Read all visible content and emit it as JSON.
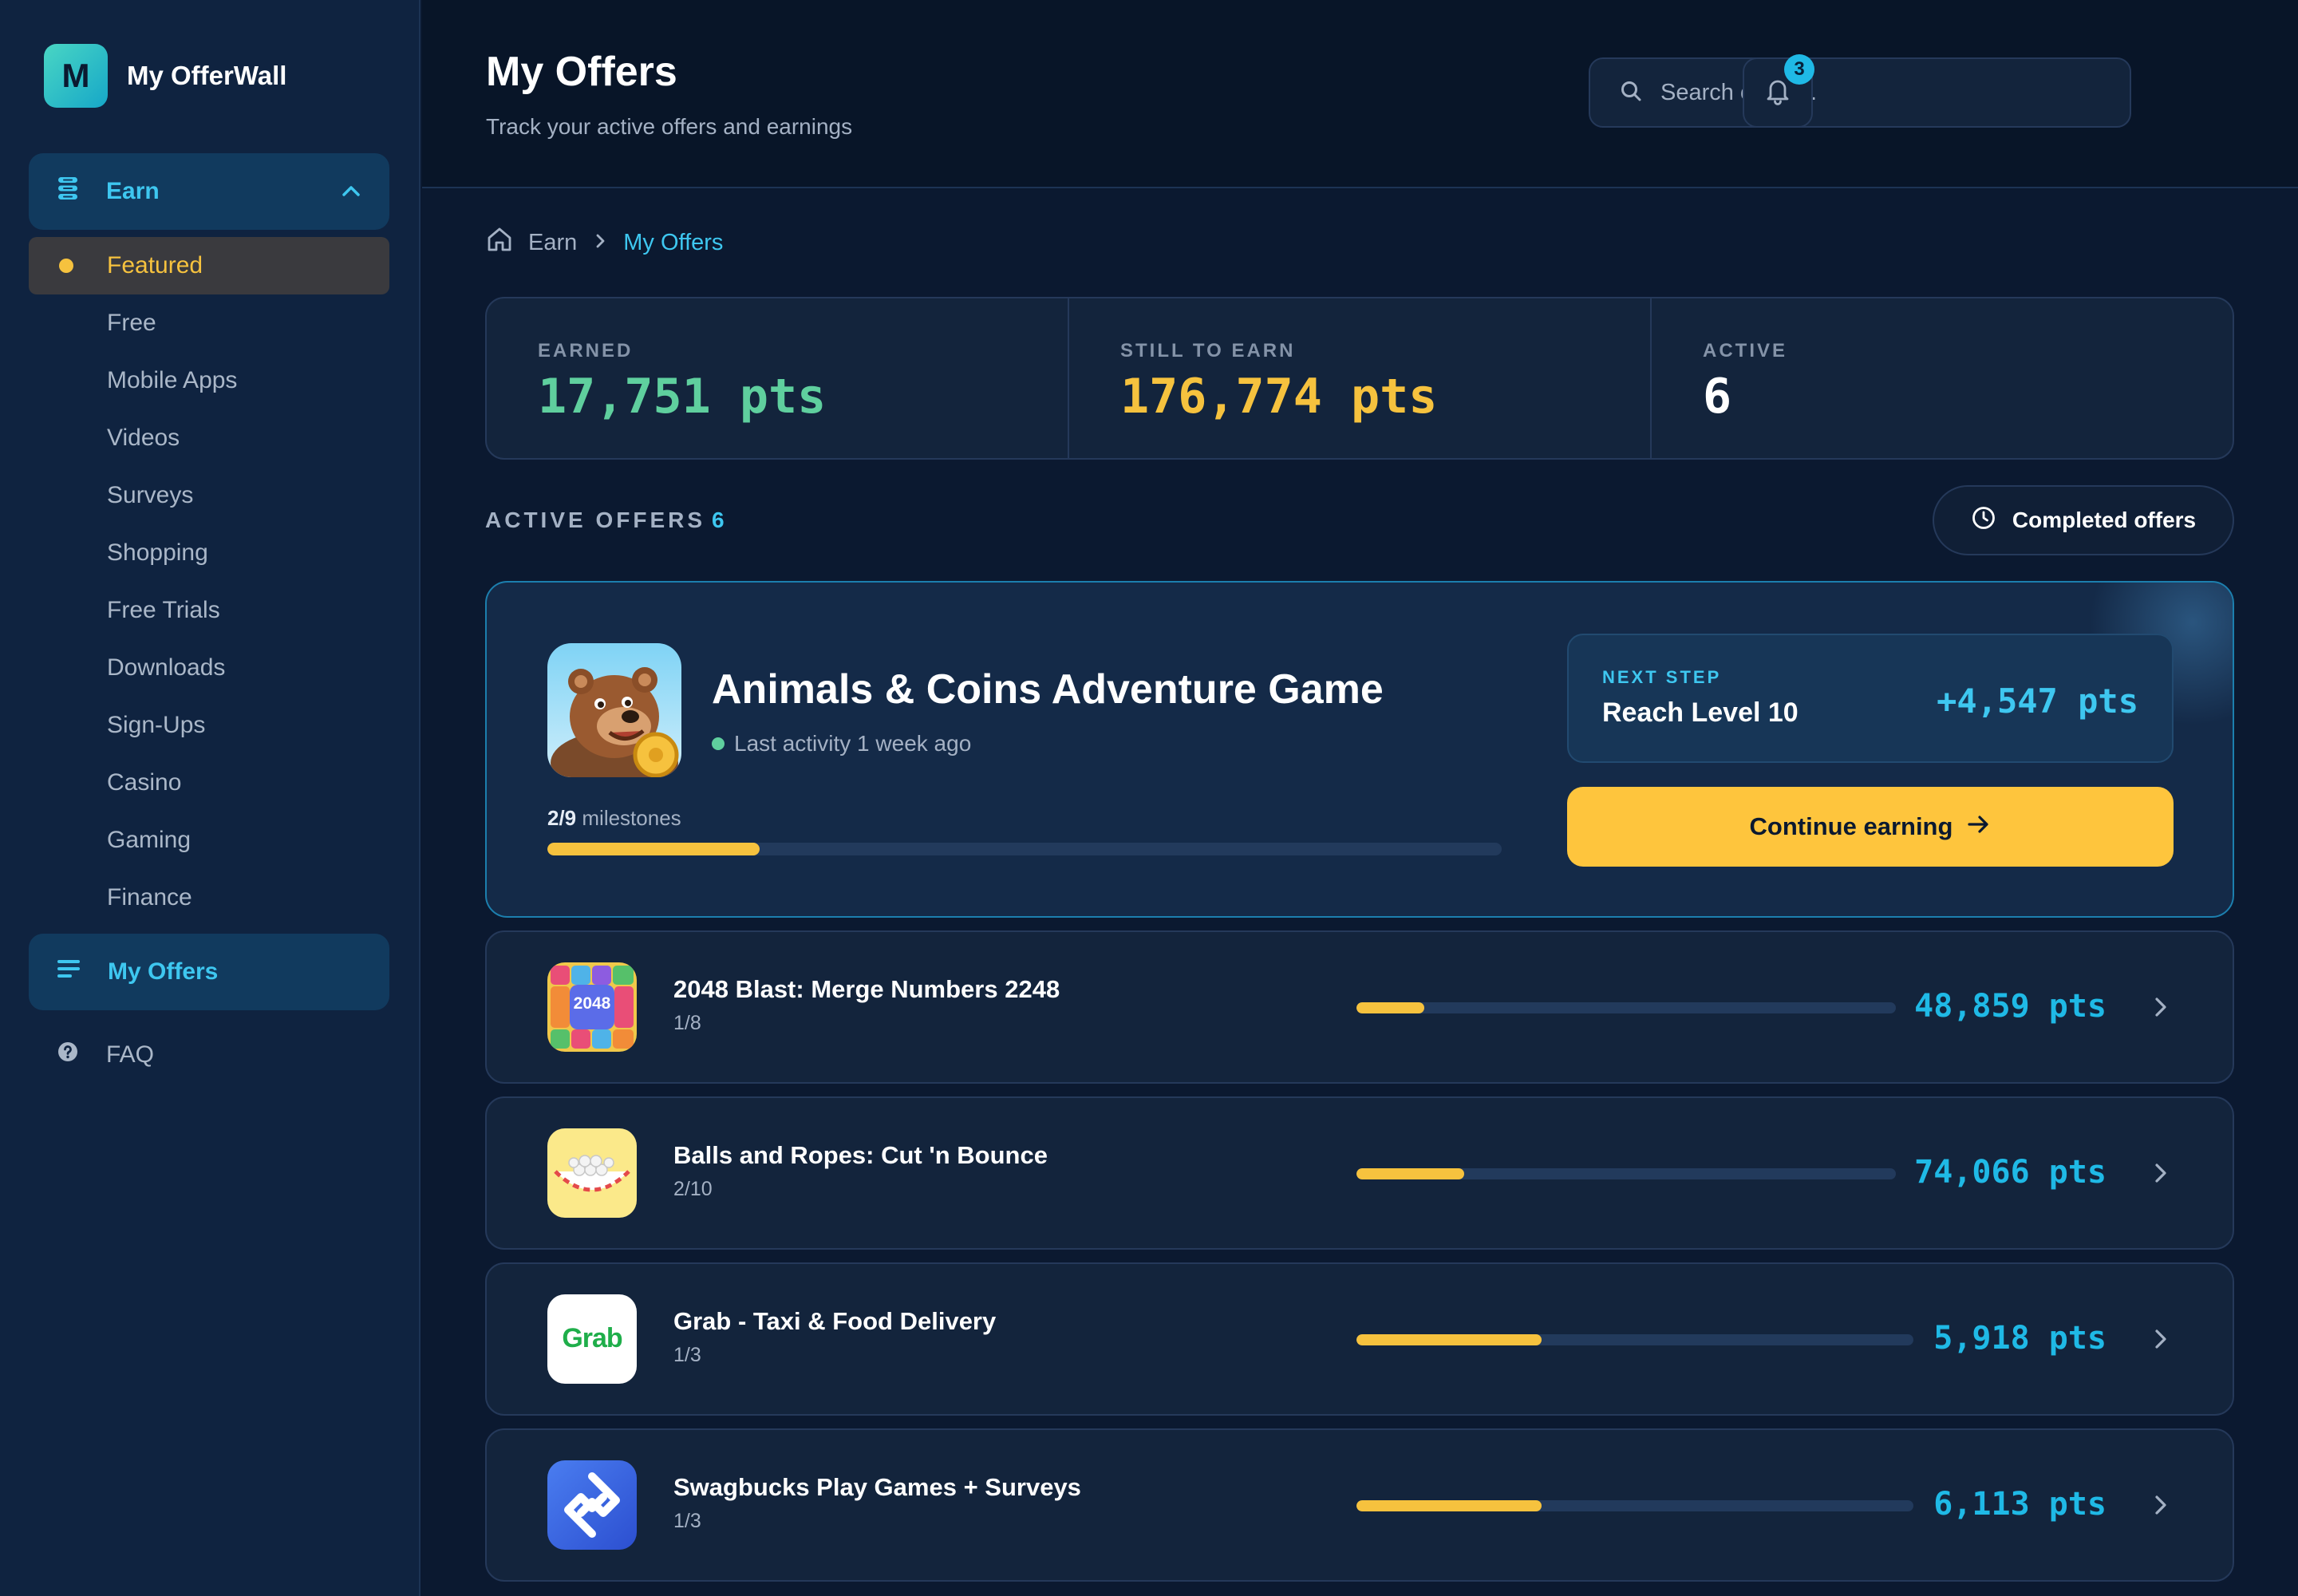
{
  "brand": {
    "logo_letter": "M",
    "name": "My OfferWall"
  },
  "sidebar": {
    "earn_label": "Earn",
    "items": [
      {
        "label": "Featured",
        "active": true
      },
      {
        "label": "Free"
      },
      {
        "label": "Mobile Apps"
      },
      {
        "label": "Videos"
      },
      {
        "label": "Surveys"
      },
      {
        "label": "Shopping"
      },
      {
        "label": "Free Trials"
      },
      {
        "label": "Downloads"
      },
      {
        "label": "Sign-Ups"
      },
      {
        "label": "Casino"
      },
      {
        "label": "Gaming"
      },
      {
        "label": "Finance"
      }
    ],
    "my_offers_label": "My Offers",
    "faq_label": "FAQ"
  },
  "header": {
    "title": "My Offers",
    "subtitle": "Track your active offers and earnings",
    "search_placeholder": "Search offers...",
    "notification_count": "3"
  },
  "breadcrumb": {
    "parent": "Earn",
    "current": "My Offers"
  },
  "stats": {
    "earned_label": "EARNED",
    "earned_value": "17,751 pts",
    "still_label": "STILL TO EARN",
    "still_value": "176,774 pts",
    "active_label": "ACTIVE",
    "active_value": "6"
  },
  "section": {
    "title": "ACTIVE OFFERS",
    "count": "6",
    "completed_label": "Completed offers"
  },
  "featured": {
    "title": "Animals & Coins Adventure Game",
    "activity": "Last activity 1 week ago",
    "milestones_done": "2/9",
    "milestones_label": "milestones",
    "progress": 0.222,
    "next_step_label": "NEXT STEP",
    "next_step_text": "Reach Level 10",
    "next_step_points": "+4,547 pts",
    "cta_label": "Continue earning"
  },
  "offers": [
    {
      "title": "2048 Blast: Merge Numbers 2248",
      "progress_text": "1/8",
      "progress": 0.125,
      "points": "48,859 pts",
      "icon_text": "2048"
    },
    {
      "title": "Balls and Ropes: Cut 'n Bounce",
      "progress_text": "2/10",
      "progress": 0.2,
      "points": "74,066 pts"
    },
    {
      "title": "Grab - Taxi & Food Delivery",
      "progress_text": "1/3",
      "progress": 0.333,
      "points": "5,918 pts",
      "icon_text": "Grab"
    },
    {
      "title": "Swagbucks Play Games + Surveys",
      "progress_text": "1/3",
      "progress": 0.333,
      "points": "6,113 pts"
    }
  ],
  "colors": {
    "accent_cyan": "#3ec7f0",
    "accent_yellow": "#f6c23e",
    "earned_green": "#5fcf9e",
    "background": "#0b1930"
  }
}
